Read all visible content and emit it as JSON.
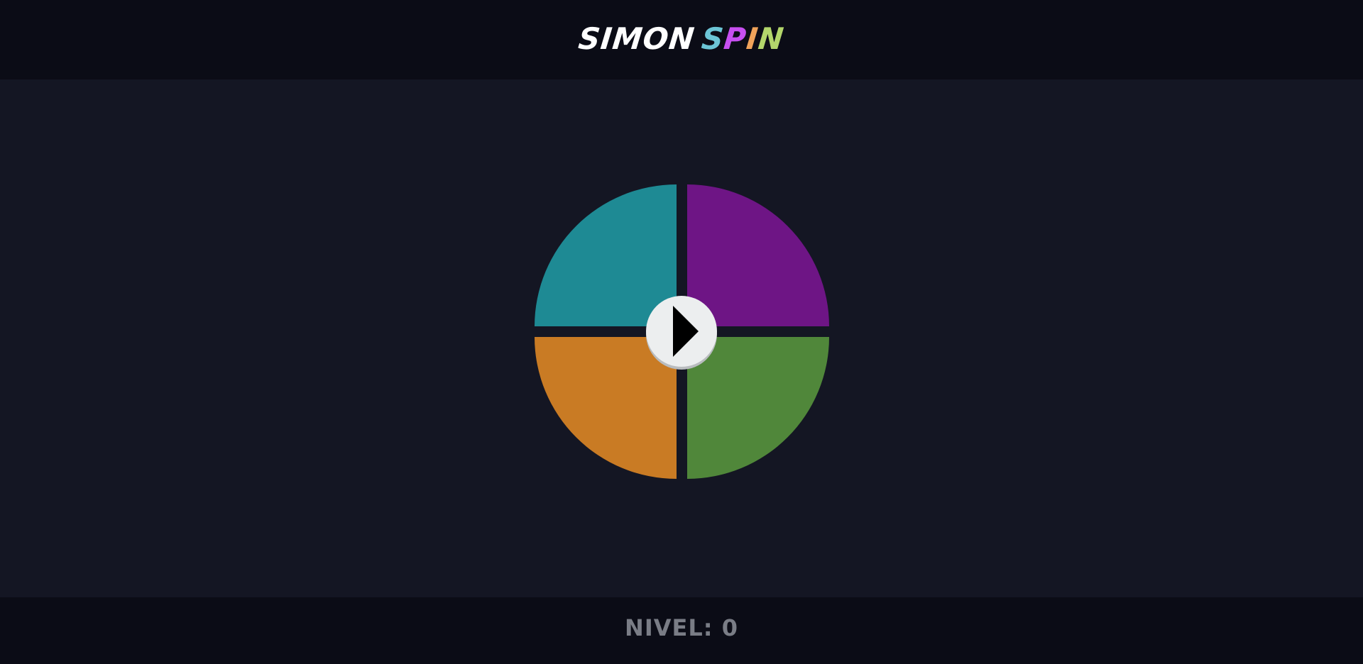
{
  "header": {
    "title_word1": "SIMON",
    "title_word2_letters": [
      {
        "char": "S",
        "color": "#6cc5d6"
      },
      {
        "char": "P",
        "color": "#c74ff0"
      },
      {
        "char": "I",
        "color": "#f0a35a"
      },
      {
        "char": "N",
        "color": "#b3d66b"
      }
    ]
  },
  "board": {
    "quadrants": [
      {
        "name": "teal",
        "color": "#1e8a94"
      },
      {
        "name": "purple",
        "color": "#6e1585"
      },
      {
        "name": "orange",
        "color": "#c97b24"
      },
      {
        "name": "green",
        "color": "#50873a"
      }
    ],
    "play_icon": "play-icon"
  },
  "footer": {
    "level_label": "NIVEL:",
    "level_value": "0"
  }
}
